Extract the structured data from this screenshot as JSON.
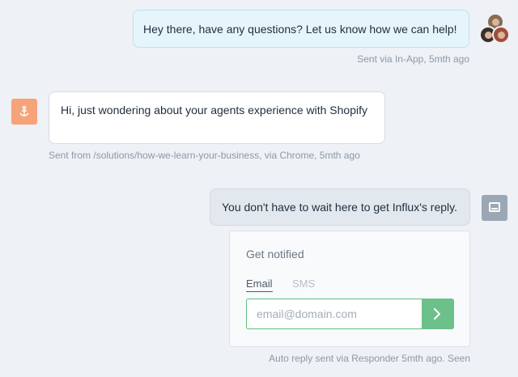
{
  "messages": {
    "agent": {
      "text": "Hey there, have any questions?  Let us know how we can help!",
      "meta": "Sent via In-App, 5mth ago"
    },
    "visitor": {
      "text": "Hi, just wondering about your agents experience with Shopify",
      "meta": "Sent from /solutions/how-we-learn-your-business, via Chrome, 5mth ago"
    },
    "bot": {
      "text": "You don't have to wait here to get Influx's reply.",
      "meta": "Auto reply sent via Responder 5mth ago. Seen"
    }
  },
  "notify": {
    "title": "Get notified",
    "tabs": [
      "Email",
      "SMS"
    ],
    "active_tab": "Email",
    "email_placeholder": "email@domain.com",
    "submit_icon": "chevron-right-icon"
  },
  "icons": {
    "visitor_avatar": "anchor-icon",
    "bot_avatar": "inbox-tray-icon",
    "team_avatar": "team-photos"
  },
  "colors": {
    "background": "#eef1f5",
    "agent_bubble": "#e6f5fc",
    "visitor_bubble": "#ffffff",
    "bot_bubble": "#e3e8ee",
    "visitor_avatar": "#f5a47a",
    "submit_button": "#6cc08a"
  }
}
